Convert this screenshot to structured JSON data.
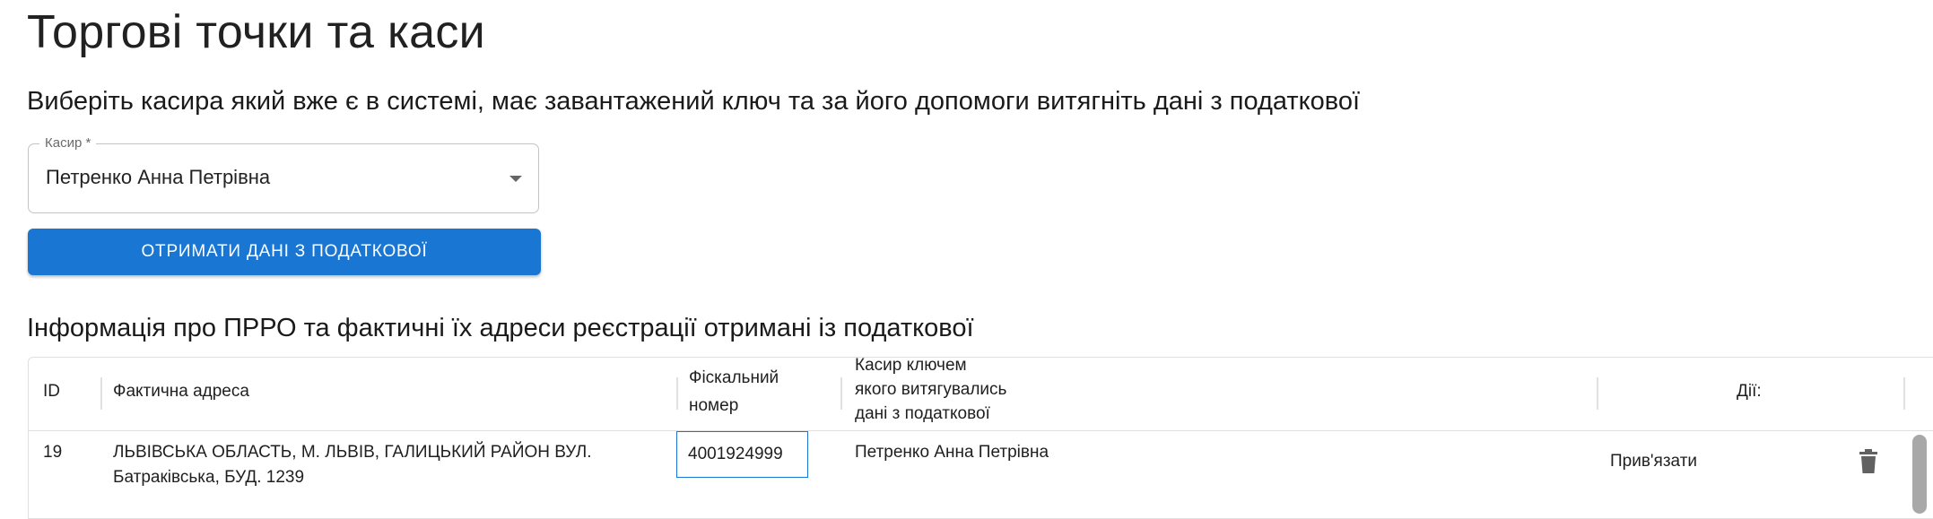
{
  "page": {
    "title": "Торгові точки та каси",
    "select_heading": "Виберіть касира який вже є в системі, має завантажений ключ та за його допомоги витягніть дані з податкової",
    "table_heading": "Інформація про ПРРО та фактичні їх адреси реєстрації отримані із податкової"
  },
  "cashier_select": {
    "label": "Касир *",
    "value": "Петренко Анна Петрівна"
  },
  "fetch_button": {
    "label": "ОТРИМАТИ ДАНІ З ПОДАТКОВОЇ"
  },
  "table": {
    "headers": {
      "id": "ID",
      "address": "Фактична адреса",
      "fiscal_line1": "Фіскальний",
      "fiscal_line2": "номер",
      "cashier_line1": "Касир ключем",
      "cashier_line2": "якого витягувались",
      "cashier_line3": "дані з податкової",
      "actions": "Дії:"
    },
    "rows": [
      {
        "id": "19",
        "address_line1": "ЛЬВІВСЬКА ОБЛАСТЬ, М. ЛЬВІВ, ГАЛИЦЬКИЙ РАЙОН ВУЛ.",
        "address_line2": "Батраківська, БУД. 1239",
        "fiscal_number": "4001924999",
        "cashier": "Петренко Анна Петрівна",
        "action_label": "Прив'язати",
        "delete_icon": "trash-icon"
      }
    ]
  },
  "colors": {
    "primary": "#1976d2",
    "border": "#e0e0e0",
    "icon": "#616161"
  }
}
